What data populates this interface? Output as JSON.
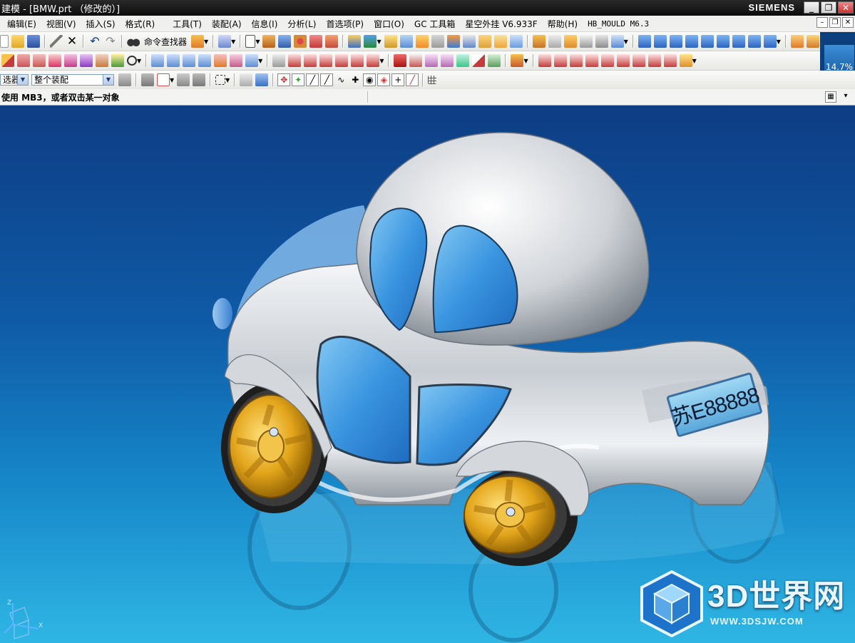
{
  "titlebar": {
    "title": "建模 - [BMW.prt （修改的）]",
    "brand": "SIEMENS",
    "buttons": [
      "_",
      "❐",
      "✕"
    ]
  },
  "menubar": {
    "items": [
      {
        "label": "编辑(E)"
      },
      {
        "label": "视图(V)"
      },
      {
        "label": "插入(S)"
      },
      {
        "label": "格式(R)"
      },
      {
        "label": "工具(T)"
      },
      {
        "label": "装配(A)"
      },
      {
        "label": "信息(I)"
      },
      {
        "label": "分析(L)"
      },
      {
        "label": "首选项(P)"
      },
      {
        "label": "窗口(O)"
      },
      {
        "label": "GC 工具箱"
      },
      {
        "label": "星空外挂 V6.933F"
      },
      {
        "label": "帮助(H)"
      },
      {
        "label": "HB_MOULD M6.3"
      }
    ],
    "mdi_buttons": [
      "–",
      "❐",
      "✕"
    ]
  },
  "toolbar1": {
    "command_finder_label": "命令查找器"
  },
  "toolbar3": {
    "filter_value": "选器",
    "assembly_scope_value": "整个装配"
  },
  "zoom": {
    "value": "14.7%"
  },
  "status": {
    "message": "使用 MB3，或者双击某一对象"
  },
  "model": {
    "plate_text": "苏E88888"
  },
  "watermark": {
    "name": "3D世界网",
    "url": "WWW.3DSJW.COM"
  },
  "triad": {
    "z_label": "Z",
    "x_label": "X"
  },
  "colors": {
    "viewport_top": "#0e3d84",
    "viewport_bottom": "#2fb6e4",
    "car_body": "#d9dde2",
    "car_glass": "#3a9be0",
    "wheel_rim": "#e3a51b",
    "tire": "#222222"
  }
}
